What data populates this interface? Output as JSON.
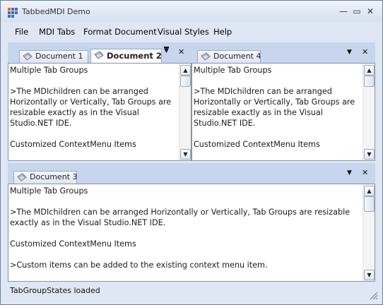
{
  "window": {
    "title": "TabbedMDI Demo"
  },
  "title_controls": {
    "minimize": "—",
    "maximize": "▭",
    "close": "✕"
  },
  "menu": {
    "items": [
      {
        "label": "File"
      },
      {
        "label": "MDI Tabs"
      },
      {
        "label": "Format Document"
      },
      {
        "label": "Visual Styles"
      },
      {
        "label": "Help"
      }
    ]
  },
  "strip_controls": {
    "dropdown": "▼",
    "close": "✕"
  },
  "groups": {
    "top_left": {
      "tabs": [
        {
          "label": "Document 1",
          "active": false
        },
        {
          "label": "Document 2",
          "active": true
        }
      ],
      "text": "Multiple Tab Groups\n\n>The MDIchildren can be arranged\nHorizontally or Vertically, Tab Groups are\nresizable exactly as in the Visual\nStudio.NET IDE.\n\nCustomized ContextMenu Items"
    },
    "top_right": {
      "tabs": [
        {
          "label": "Document 4",
          "active": false
        }
      ],
      "text": "Multiple Tab Groups\n\n>The MDIchildren can be arranged\nHorizontally or Vertically, Tab Groups are\nresizable exactly as in the Visual\nStudio.NET IDE.\n\nCustomized ContextMenu Items"
    },
    "bottom": {
      "tabs": [
        {
          "label": "Document 3",
          "active": false
        }
      ],
      "text": "Multiple Tab Groups\n\n>The MDIchildren can be arranged Horizontally or Vertically, Tab Groups are resizable\nexactly as in the Visual Studio.NET IDE.\n\nCustomized ContextMenu Items\n\n>Custom items can be added to the existing context menu item."
    }
  },
  "scrollbar": {
    "up": "▲",
    "down": "▼"
  },
  "status": {
    "text": "TabGroupStates loaded"
  },
  "colors": {
    "frame": "#dfe7f4",
    "tab_strip": "#c7d6ec",
    "text": "#1a1a1a"
  }
}
